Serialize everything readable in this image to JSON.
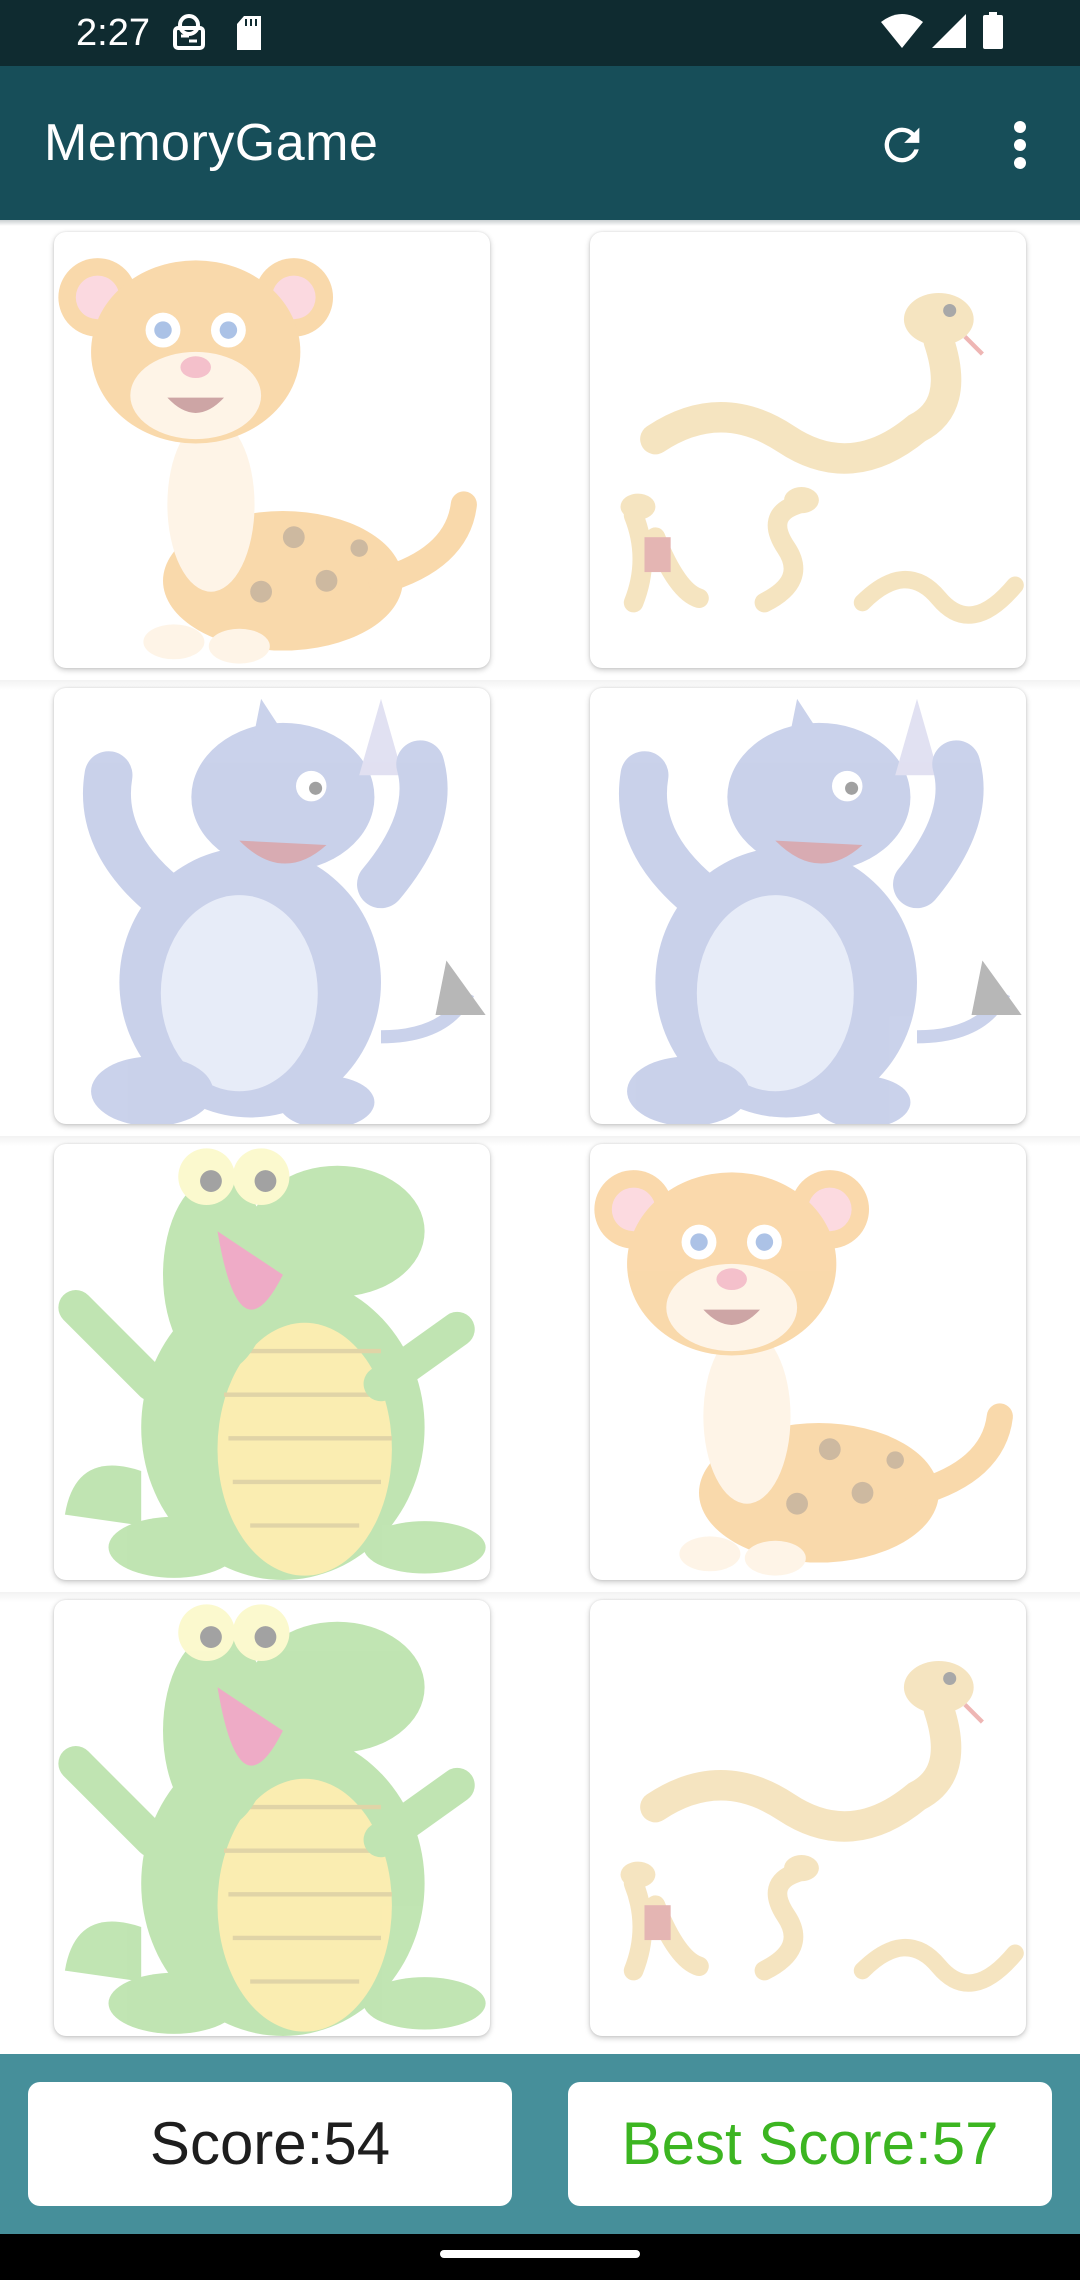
{
  "status_bar": {
    "time": "2:27",
    "icons": [
      "privacy-icon",
      "sd-card-icon",
      "wifi-icon",
      "signal-icon",
      "battery-icon"
    ]
  },
  "app_bar": {
    "title": "MemoryGame",
    "actions": [
      "refresh-icon",
      "more-vert-icon"
    ],
    "background": "#174e59"
  },
  "board": {
    "rows": 4,
    "columns": 2,
    "cards": [
      {
        "animal": "leopard",
        "state": "revealed-faded"
      },
      {
        "animal": "snake",
        "state": "revealed-faded"
      },
      {
        "animal": "rhino",
        "state": "revealed-faded"
      },
      {
        "animal": "rhino",
        "state": "revealed-faded"
      },
      {
        "animal": "crocodile",
        "state": "revealed-faded"
      },
      {
        "animal": "leopard",
        "state": "revealed-faded"
      },
      {
        "animal": "crocodile",
        "state": "revealed-faded"
      },
      {
        "animal": "snake",
        "state": "revealed-faded"
      }
    ]
  },
  "scores": {
    "score_label": "Score:54",
    "best_score_label": "Best Score:57",
    "best_score_color": "#3cb521",
    "bar_color": "#468f9a"
  }
}
